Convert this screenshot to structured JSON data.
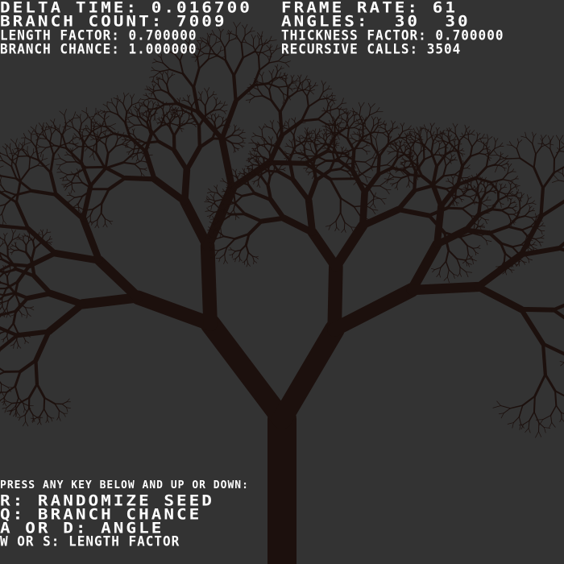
{
  "stats_left": {
    "delta_time": "DELTA TIME: 0.016700",
    "branch_count": "BRANCH COUNT: 7009",
    "length_factor": "LENGTH FACTOR: 0.700000",
    "branch_chance": "BRANCH CHANCE: 1.000000"
  },
  "stats_right": {
    "frame_rate": "FRAME RATE: 61",
    "angles": "ANGLES:  30  30",
    "thickness_factor": "THICKNESS FACTOR: 0.700000",
    "recursive_calls": "RECURSIVE CALLS: 3504"
  },
  "controls": {
    "intro": "PRESS ANY KEY BELOW AND UP OR DOWN:",
    "r": "R: RANDOMIZE SEED",
    "q": "Q: BRANCH CHANCE",
    "ad": "A OR D: ANGLE",
    "ws": "W OR S: LENGTH FACTOR"
  },
  "tree": {
    "angle_left": 30,
    "angle_right": 30,
    "length_factor": 0.7,
    "thickness_factor": 0.7,
    "branch_chance": 1.0,
    "color": "#1c100d",
    "background": "#333333"
  }
}
